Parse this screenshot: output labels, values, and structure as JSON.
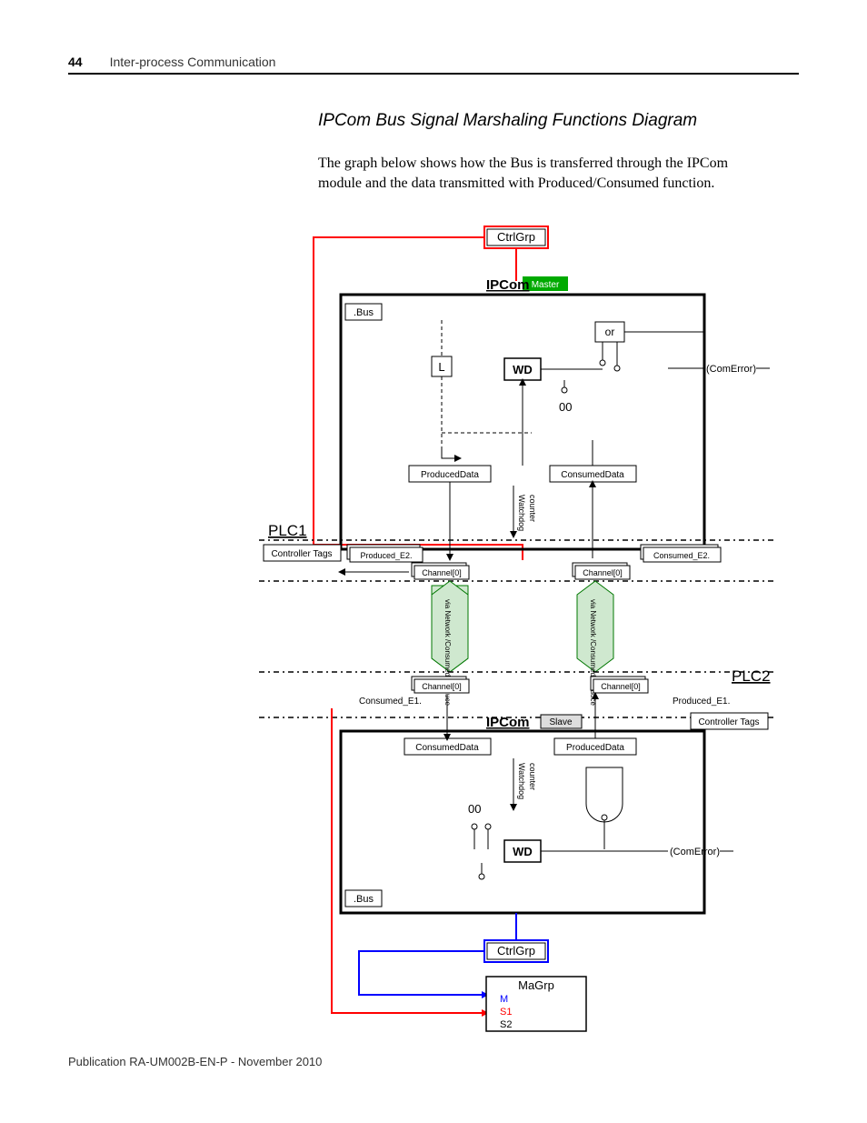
{
  "header": {
    "page_number": "44",
    "chapter": "Inter-process Communication"
  },
  "section": {
    "title": "IPCom Bus Signal Marshaling Functions Diagram",
    "body": "The graph below shows how the Bus is transferred through the IPCom module and the data transmitted with Produced/Consumed function."
  },
  "diagram": {
    "top": {
      "ctrl_grp": "CtrlGrp",
      "ipcom": "IPCom",
      "master": "Master",
      "bus": ".Bus",
      "or": "or",
      "L": "L",
      "WD": "WD",
      "zeros": "00",
      "com_error": "(ComError)",
      "produced_data": "ProducedData",
      "consumed_data": "ConsumedData",
      "watchdog": "Watchdog",
      "counter": "counter"
    },
    "plc1": {
      "label": "PLC1",
      "controller_tags": "Controller Tags",
      "produced_e2": "Produced_E2.",
      "consumed_e2": "Consumed_E2.",
      "channel_left": "Channel[0]",
      "channel_right": "Channel[0]"
    },
    "network": {
      "left": "via Network /Consumed Produce",
      "right": "via Network /Consumed Produce"
    },
    "plc2": {
      "label": "PLC2",
      "controller_tags": "Controller Tags",
      "channel_left": "Channel[0]",
      "channel_right": "Channel[0]",
      "consumed_e1": "Consumed_E1.",
      "produced_e1": "Produced_E1."
    },
    "bottom": {
      "ipcom": "IPCom",
      "slave": "Slave",
      "consumed_data": "ConsumedData",
      "produced_data": "ProducedData",
      "watchdog": "Watchdog",
      "counter": "counter",
      "zeros": "00",
      "WD": "WD",
      "com_error": "(ComError)",
      "bus": ".Bus",
      "ctrl_grp": "CtrlGrp",
      "magrp": "MaGrp",
      "M": "M",
      "S1": "S1",
      "S2": "S2"
    }
  },
  "footer": {
    "publication": "Publication RA-UM002B-EN-P - November 2010"
  }
}
